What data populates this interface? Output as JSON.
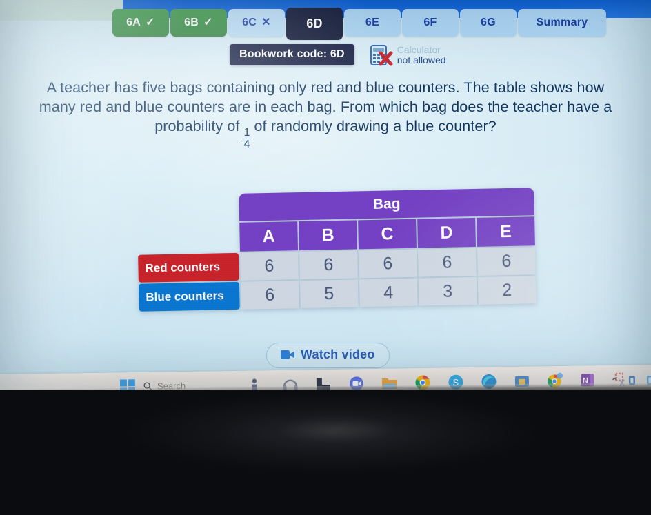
{
  "app": {
    "platform_name": "Sparx Maths question view"
  },
  "tabs": [
    {
      "label": "6A",
      "state": "correct",
      "marker": "✓"
    },
    {
      "label": "6B",
      "state": "correct",
      "marker": "✓"
    },
    {
      "label": "6C",
      "state": "incorrect",
      "marker": "✕"
    },
    {
      "label": "6D",
      "state": "active",
      "marker": ""
    },
    {
      "label": "6E",
      "state": "pending",
      "marker": ""
    },
    {
      "label": "6F",
      "state": "pending",
      "marker": ""
    },
    {
      "label": "6G",
      "state": "pending",
      "marker": ""
    },
    {
      "label": "Summary",
      "state": "pending",
      "marker": ""
    }
  ],
  "bookwork": {
    "code_label": "Bookwork code: 6D",
    "calculator_line1": "Calculator",
    "calculator_line2": "not allowed",
    "calculator_icon": "calculator-not-allowed-icon"
  },
  "question": {
    "line1": "A teacher has five bags containing only red and blue counters. The table shows",
    "line2": "how many red and blue counters are in each bag. From which bag does the",
    "line3_before": "teacher have a probability of",
    "fraction_numerator": "1",
    "fraction_denominator": "4",
    "line3_after": "of randomly drawing a blue counter?"
  },
  "table": {
    "caption": "Bag",
    "columns": [
      "A",
      "B",
      "C",
      "D",
      "E"
    ],
    "rows": [
      {
        "label": "Red counters",
        "accent": "#c8232b",
        "values": [
          "6",
          "6",
          "6",
          "6",
          "6"
        ]
      },
      {
        "label": "Blue counters",
        "accent": "#0a76d0",
        "values": [
          "6",
          "5",
          "4",
          "3",
          "2"
        ]
      }
    ],
    "header_color": "#7441c4",
    "cell_color": "#ced7e2"
  },
  "watch_video": {
    "label": "Watch video",
    "icon": "video-camera-icon"
  },
  "taskbar": {
    "start_icon": "windows-start-icon",
    "search_placeholder": "Search",
    "search_icon": "search-icon",
    "apps": [
      {
        "name": "teams-icon"
      },
      {
        "name": "headset-icon"
      },
      {
        "name": "file-explorer-icon"
      },
      {
        "name": "zoom-icon"
      },
      {
        "name": "folder-icon"
      },
      {
        "name": "chrome-icon"
      },
      {
        "name": "skype-icon"
      },
      {
        "name": "edge-icon"
      },
      {
        "name": "microsoft-store-icon"
      },
      {
        "name": "chrome-profile-icon"
      },
      {
        "name": "onenote-icon"
      },
      {
        "name": "snipping-tool-icon"
      }
    ],
    "tray": {
      "chevron": "⌃",
      "icons": [
        {
          "name": "onedrive-icon"
        },
        {
          "name": "network-icon"
        }
      ]
    }
  }
}
